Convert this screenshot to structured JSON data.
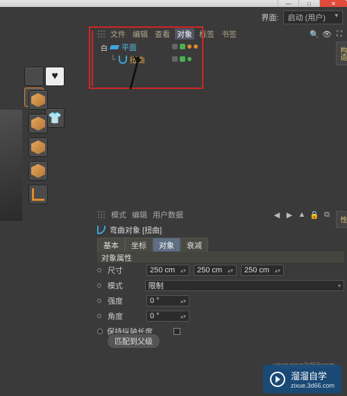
{
  "window": {
    "min": "—",
    "max": "□",
    "close": "✕"
  },
  "top": {
    "layout_label": "界面:",
    "layout_value": "启动 (用户)"
  },
  "menu": {
    "items": [
      "文件",
      "编辑",
      "查看",
      "对象",
      "标签",
      "书签"
    ]
  },
  "objects": {
    "tree": [
      {
        "expand": "白",
        "label": "平面"
      },
      {
        "indent": "└",
        "label": "扭曲"
      }
    ]
  },
  "attr_menu": {
    "items": [
      "模式",
      "编辑",
      "用户数据"
    ]
  },
  "attr_title": "弯曲对象 [扭曲]",
  "tabs": {
    "items": [
      "基本",
      "坐标",
      "对象",
      "衰减"
    ],
    "active_index": 2
  },
  "section": "对象属性",
  "props": {
    "size_label": "尺寸",
    "size": [
      "250 cm",
      "250 cm",
      "250 cm"
    ],
    "mode_label": "模式",
    "mode_value": "限制",
    "strength_label": "强度",
    "strength_value": "0 °",
    "angle_label": "角度",
    "angle_value": "0 °",
    "keep_label": "保持纵轴长度",
    "button": "匹配到父级"
  },
  "right_tabs": [
    "构造",
    "属性"
  ],
  "watermark": {
    "brand": "溜溜自学",
    "url": "zixue.3d66.com"
  },
  "wm_url": "yingyong3d66com"
}
